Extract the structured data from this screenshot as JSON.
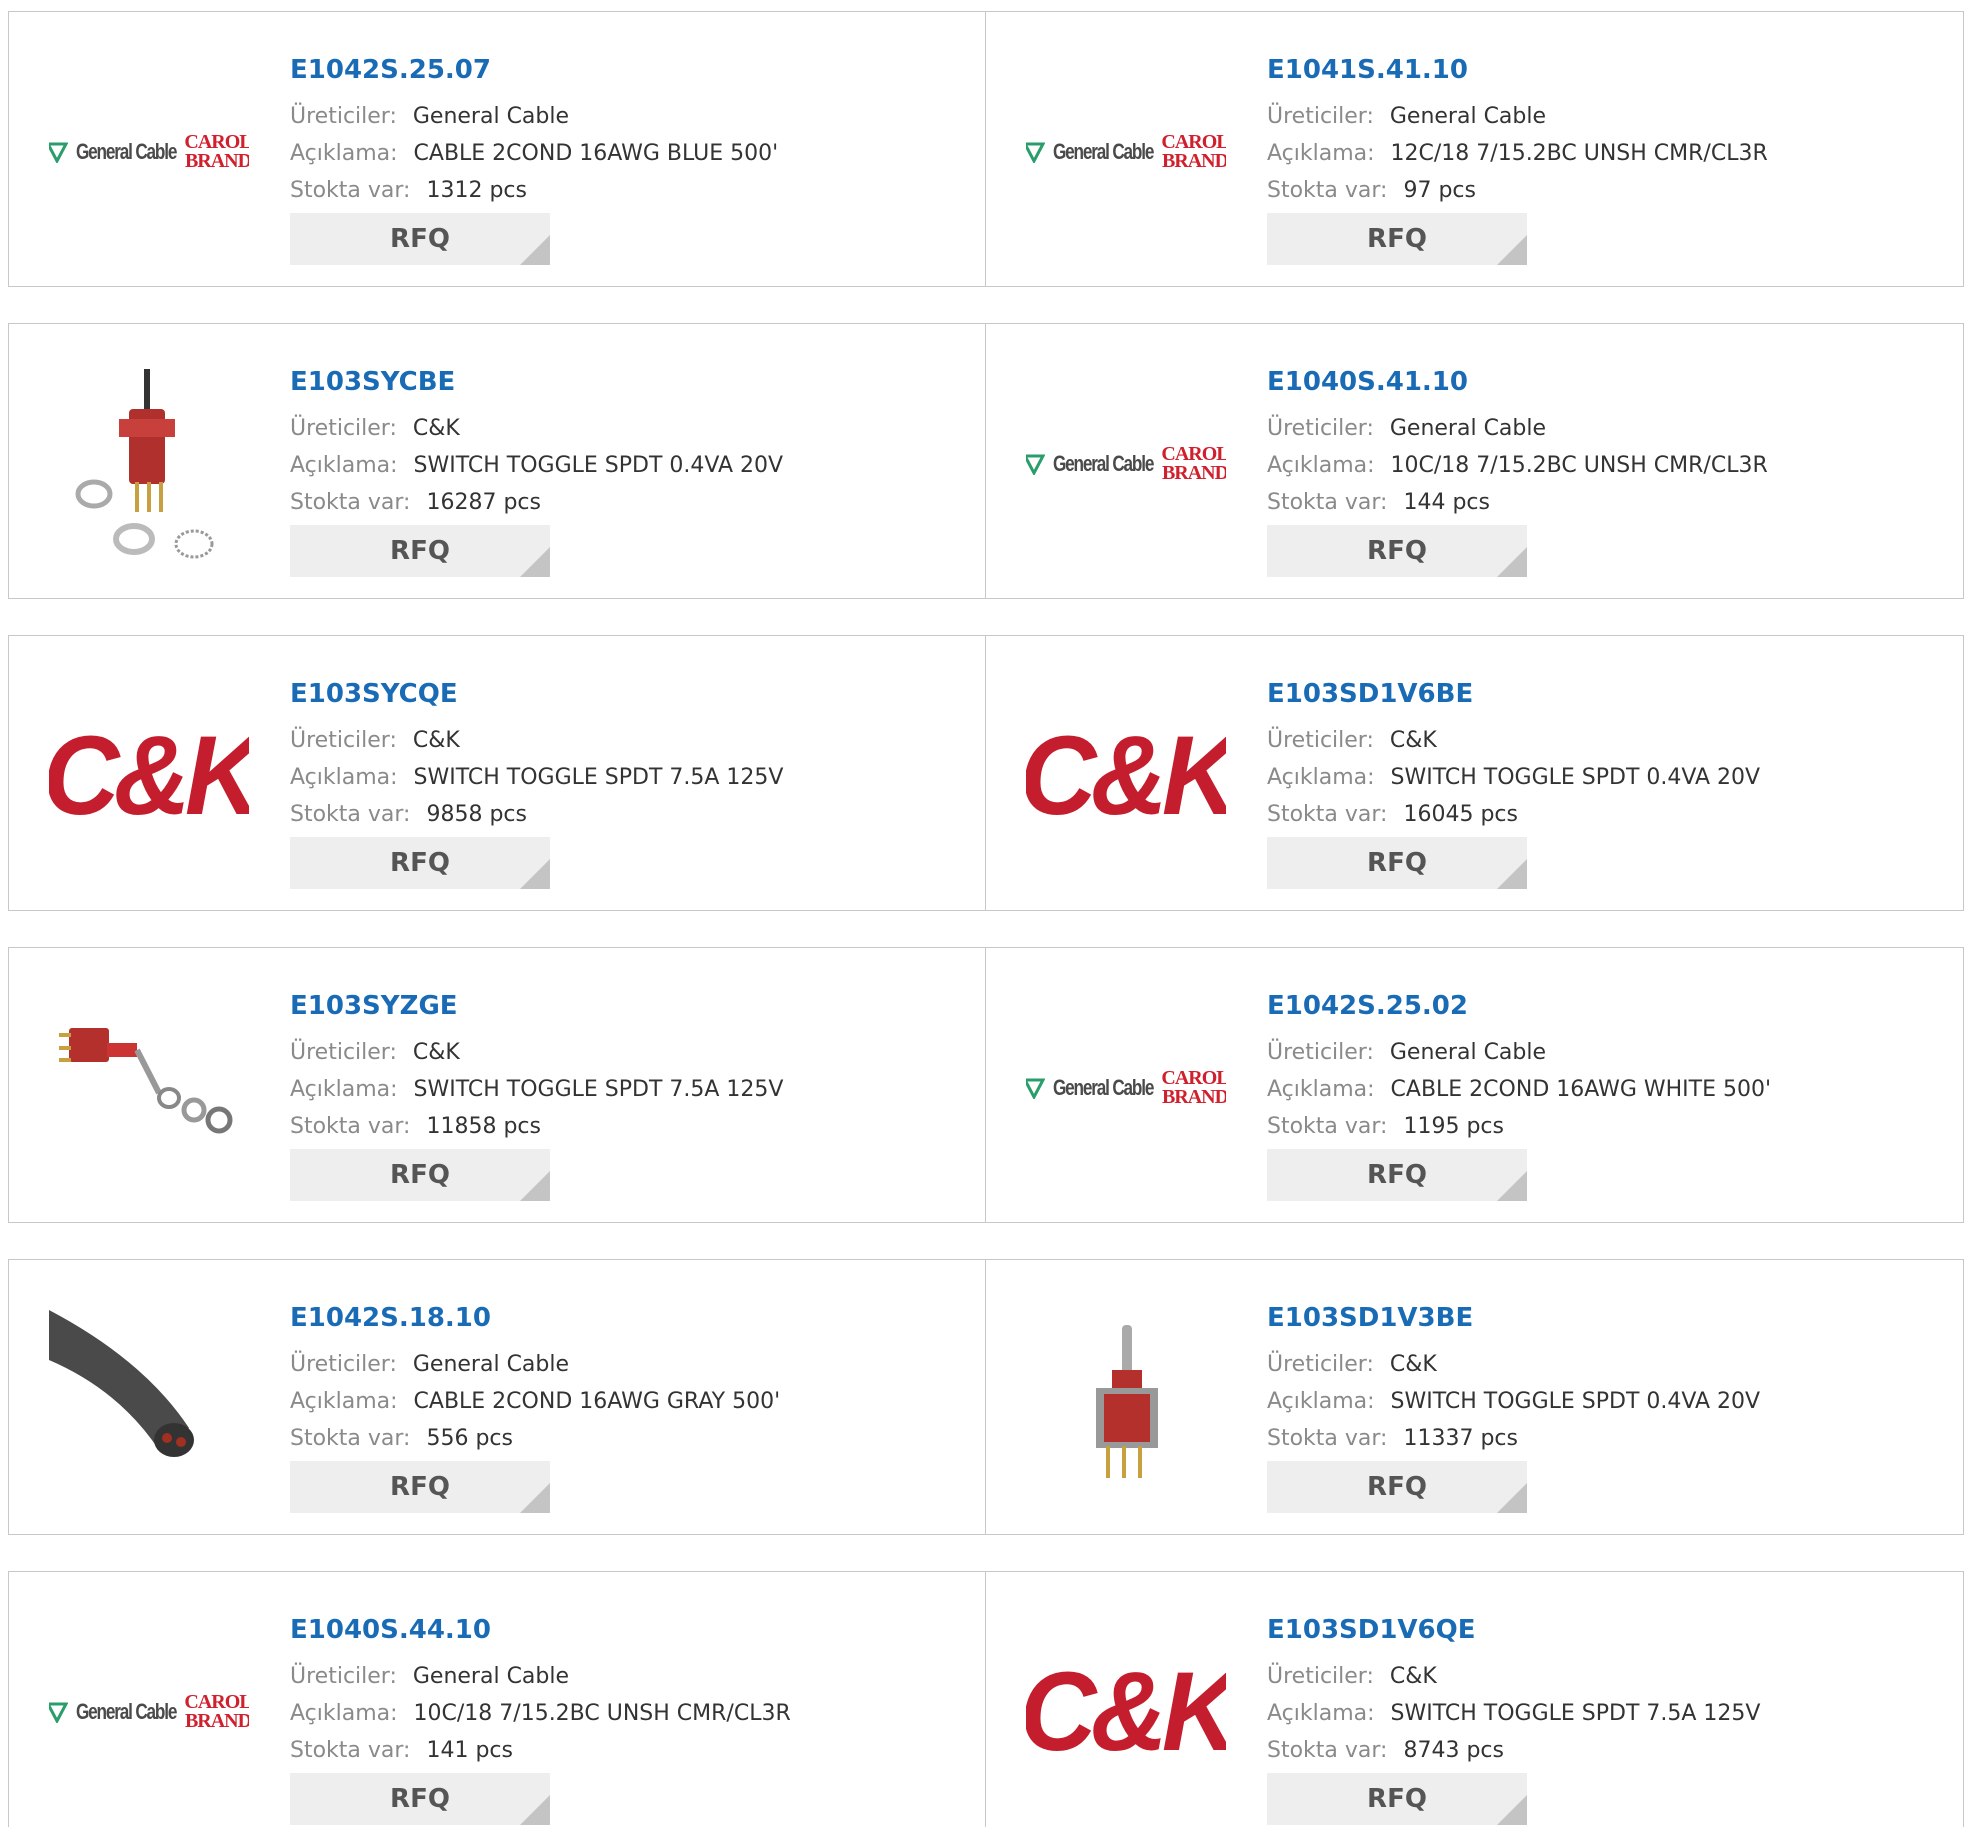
{
  "labels": {
    "manufacturer": "Üreticiler:",
    "description": "Açıklama:",
    "stock": "Stokta var:",
    "rfq": "RFQ"
  },
  "colors": {
    "part_link": "#1a6bb5",
    "brand_red": "#c41e2e",
    "button_bg": "#eeeeee"
  },
  "logo_text": {
    "general_cable": "General Cable",
    "carol_top": "CAROL",
    "carol_bottom": "BRAND",
    "ck": "C&K"
  },
  "products": [
    {
      "part": "E1042S.25.07",
      "manufacturer": "General Cable",
      "description": "CABLE 2COND 16AWG BLUE 500'",
      "stock": "1312 pcs",
      "image": "general-cable-logo"
    },
    {
      "part": "E1041S.41.10",
      "manufacturer": "General Cable",
      "description": "12C/18 7/15.2BC UNSH CMR/CL3R",
      "stock": "97 pcs",
      "image": "general-cable-logo"
    },
    {
      "part": "E103SYCBE",
      "manufacturer": "C&K",
      "description": "SWITCH TOGGLE SPDT 0.4VA 20V",
      "stock": "16287 pcs",
      "image": "toggle-switch-photo-upright"
    },
    {
      "part": "E1040S.41.10",
      "manufacturer": "General Cable",
      "description": "10C/18 7/15.2BC UNSH CMR/CL3R",
      "stock": "144 pcs",
      "image": "general-cable-logo"
    },
    {
      "part": "E103SYCQE",
      "manufacturer": "C&K",
      "description": "SWITCH TOGGLE SPDT 7.5A 125V",
      "stock": "9858 pcs",
      "image": "ck-logo"
    },
    {
      "part": "E103SD1V6BE",
      "manufacturer": "C&K",
      "description": "SWITCH TOGGLE SPDT 0.4VA 20V",
      "stock": "16045 pcs",
      "image": "ck-logo"
    },
    {
      "part": "E103SYZGE",
      "manufacturer": "C&K",
      "description": "SWITCH TOGGLE SPDT 7.5A 125V",
      "stock": "11858 pcs",
      "image": "toggle-switch-photo-side"
    },
    {
      "part": "E1042S.25.02",
      "manufacturer": "General Cable",
      "description": "CABLE 2COND 16AWG WHITE 500'",
      "stock": "1195 pcs",
      "image": "general-cable-logo"
    },
    {
      "part": "E1042S.18.10",
      "manufacturer": "General Cable",
      "description": "CABLE 2COND 16AWG GRAY 500'",
      "stock": "556 pcs",
      "image": "gray-cable-photo"
    },
    {
      "part": "E103SD1V3BE",
      "manufacturer": "C&K",
      "description": "SWITCH TOGGLE SPDT 0.4VA 20V",
      "stock": "11337 pcs",
      "image": "toggle-switch-photo-bracket"
    },
    {
      "part": "E1040S.44.10",
      "manufacturer": "General Cable",
      "description": "10C/18 7/15.2BC UNSH CMR/CL3R",
      "stock": "141 pcs",
      "image": "general-cable-logo"
    },
    {
      "part": "E103SD1V6QE",
      "manufacturer": "C&K",
      "description": "SWITCH TOGGLE SPDT 7.5A 125V",
      "stock": "8743 pcs",
      "image": "ck-logo"
    }
  ]
}
